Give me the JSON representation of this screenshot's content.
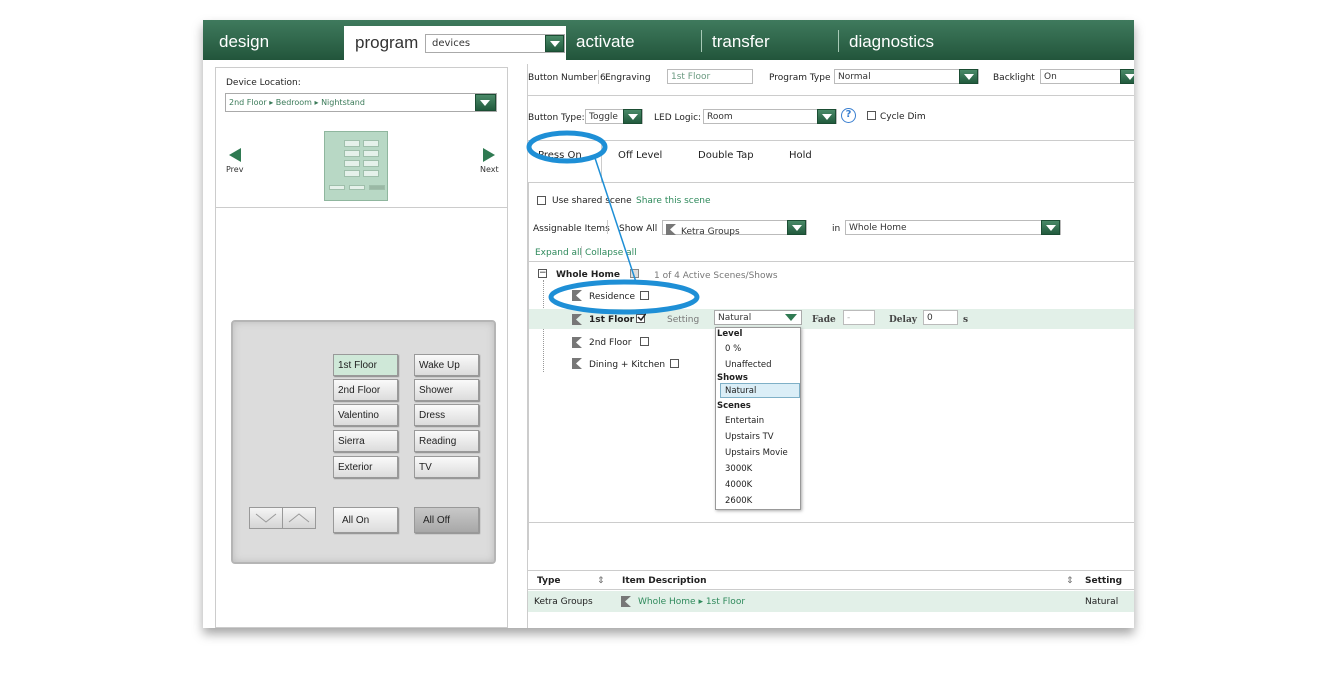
{
  "nav": {
    "tabs": [
      "design",
      "program",
      "activate",
      "transfer",
      "diagnostics"
    ],
    "program_select": "devices"
  },
  "left": {
    "device_location_label": "Device Location:",
    "device_location_value": "2nd Floor ▸ Bedroom ▸ Nightstand",
    "prev": "Prev",
    "next": "Next",
    "keypad_buttons": [
      "1st Floor",
      "Wake Up",
      "2nd Floor",
      "Shower",
      "Valentino",
      "Dress",
      "Sierra",
      "Reading",
      "Exterior",
      "TV"
    ],
    "all_on": "All On",
    "all_off": "All Off"
  },
  "right": {
    "button_number": "Button Number 6",
    "engraving_label": "Engraving",
    "engraving_value": "1st Floor",
    "program_type_label": "Program Type",
    "program_type_value": "Normal",
    "backlight_label": "Backlight",
    "backlight_value": "On",
    "button_type_label": "Button Type:",
    "button_type_value": "Toggle",
    "led_logic_label": "LED Logic:",
    "led_logic_value": "Room",
    "help": "?",
    "cycle_dim": "Cycle Dim",
    "tabs": [
      "Press On",
      "Off Level",
      "Double Tap",
      "Hold"
    ],
    "use_shared_scene": "Use shared scene",
    "share_this_scene": "Share this scene",
    "assignable_items": "Assignable Items",
    "show_all": "Show All",
    "ketra_groups": "Ketra Groups",
    "in_label": "in",
    "in_value": "Whole Home",
    "expand_all": "Expand all",
    "collapse_all": "Collapse all",
    "tree": {
      "root": "Whole Home",
      "root_count": "1 of 4 Active Scenes/Shows",
      "children": [
        "Residence",
        "1st Floor",
        "2nd Floor",
        "Dining + Kitchen"
      ]
    },
    "setting_label": "Setting",
    "setting_value": "Natural",
    "fade_label": "Fade",
    "fade_value": "-",
    "delay_label": "Delay",
    "delay_value": "0",
    "seconds": "s",
    "dropdown": {
      "level_header": "Level",
      "level_items": [
        "0 %",
        "Unaffected"
      ],
      "shows_header": "Shows",
      "shows_items": [
        "Natural"
      ],
      "scenes_header": "Scenes",
      "scenes_items": [
        "Entertain",
        "Upstairs TV",
        "Upstairs Movie",
        "3000K",
        "4000K",
        "2600K"
      ]
    },
    "table": {
      "headers": [
        "Type",
        "Item Description",
        "Setting"
      ],
      "row": {
        "type": "Ketra Groups",
        "description": "Whole Home ▸ 1st Floor",
        "setting": "Natural"
      }
    }
  },
  "colors": {
    "brand_green": "#2f6b4c",
    "highlight": "#1e8fd6",
    "row_highlight": "#e2f0e8"
  }
}
